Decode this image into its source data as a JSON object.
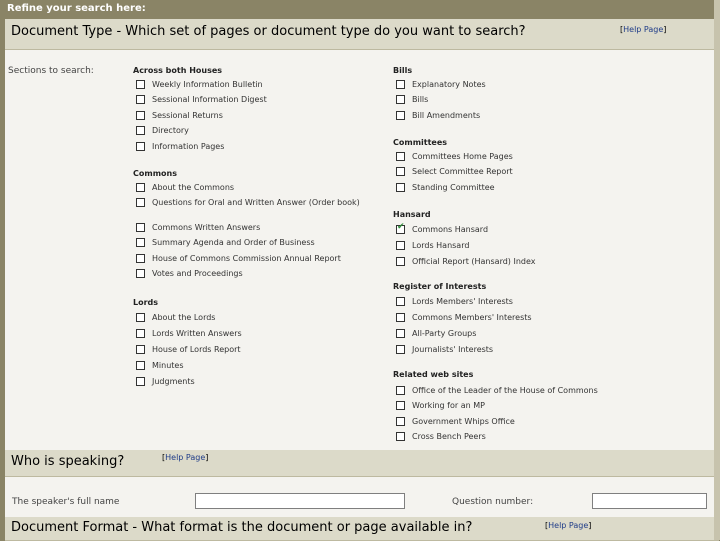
{
  "header": {
    "title": "Refine your search here:"
  },
  "doc_type": {
    "title": "Document Type - Which set of pages or document type do you want to search?",
    "help": "Help Page",
    "sections_label": "Sections to search:",
    "groups": {
      "across": {
        "title": "Across both Houses",
        "items": [
          {
            "label": "Weekly Information Bulletin",
            "checked": false
          },
          {
            "label": "Sessional Information Digest",
            "checked": false
          },
          {
            "label": "Sessional Returns",
            "checked": false
          },
          {
            "label": "Directory",
            "checked": false
          },
          {
            "label": "Information Pages",
            "checked": false
          }
        ]
      },
      "commons": {
        "title": "Commons",
        "items": [
          {
            "label": "About the Commons",
            "checked": false
          },
          {
            "label": "Questions for Oral and Written Answer (Order book)",
            "checked": false
          },
          {
            "label": "Commons Written Answers",
            "checked": false
          },
          {
            "label": "Summary Agenda and Order of Business",
            "checked": false
          },
          {
            "label": "House of Commons Commission Annual Report",
            "checked": false
          },
          {
            "label": "Votes and Proceedings",
            "checked": false
          }
        ]
      },
      "lords": {
        "title": "Lords",
        "items": [
          {
            "label": "About the Lords",
            "checked": false
          },
          {
            "label": "Lords Written Answers",
            "checked": false
          },
          {
            "label": "House of Lords Report",
            "checked": false
          },
          {
            "label": "Minutes",
            "checked": false
          },
          {
            "label": "Judgments",
            "checked": false
          }
        ]
      },
      "bills": {
        "title": "Bills",
        "items": [
          {
            "label": "Explanatory Notes",
            "checked": false
          },
          {
            "label": "Bills",
            "checked": false
          },
          {
            "label": "Bill Amendments",
            "checked": false
          }
        ]
      },
      "committees": {
        "title": "Committees",
        "items": [
          {
            "label": "Committees Home Pages",
            "checked": false
          },
          {
            "label": "Select Committee Report",
            "checked": false
          },
          {
            "label": "Standing Committee",
            "checked": false
          }
        ]
      },
      "hansard": {
        "title": "Hansard",
        "items": [
          {
            "label": "Commons Hansard",
            "checked": true
          },
          {
            "label": "Lords Hansard",
            "checked": false
          },
          {
            "label": "Official Report (Hansard) Index",
            "checked": false
          }
        ]
      },
      "register": {
        "title": "Register of Interests",
        "items": [
          {
            "label": "Lords Members' Interests",
            "checked": false
          },
          {
            "label": "Commons Members' Interests",
            "checked": false
          },
          {
            "label": "All-Party Groups",
            "checked": false
          },
          {
            "label": "Journalists' Interests",
            "checked": false
          }
        ]
      },
      "related": {
        "title": "Related web sites",
        "items": [
          {
            "label": "Office of the Leader of the House of Commons",
            "checked": false
          },
          {
            "label": "Working for an MP",
            "checked": false
          },
          {
            "label": "Government Whips Office",
            "checked": false
          },
          {
            "label": "Cross Bench Peers",
            "checked": false
          }
        ]
      }
    }
  },
  "speaker": {
    "title": "Who is speaking?",
    "help": "Help Page",
    "full_name_label": "The speaker's full name",
    "full_name_value": "",
    "question_label": "Question number:",
    "question_value": ""
  },
  "format": {
    "title": "Document Format - What format is the document or page available in?",
    "help": "Help Page"
  }
}
